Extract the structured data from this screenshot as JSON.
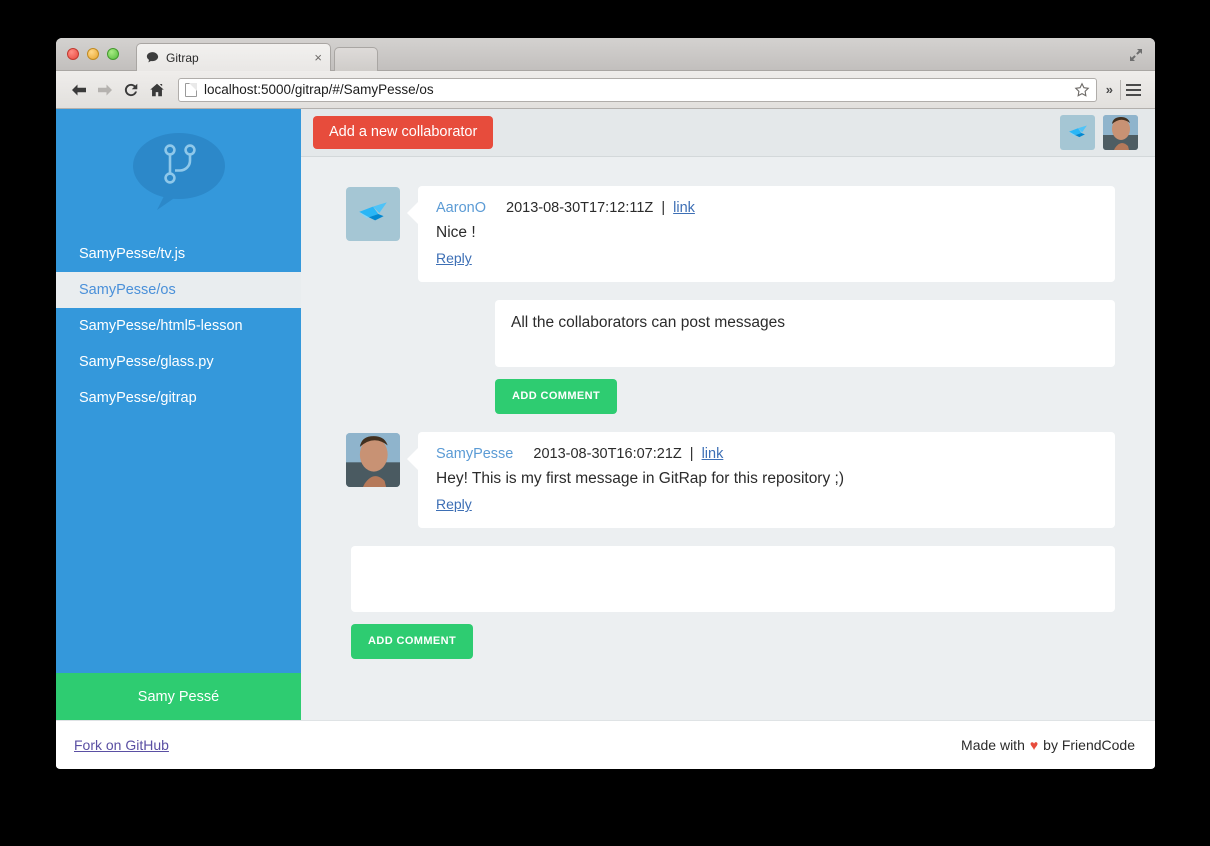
{
  "browser": {
    "tab_title": "Gitrap",
    "tab_close_label": "×",
    "url": "localhost:5000/gitrap/#/SamyPesse/os",
    "chevrons_label": "»",
    "nav": {
      "back": "back-arrow",
      "forward": "forward-arrow",
      "reload": "reload-arrow",
      "home": "home-icon",
      "bookmark": "star-icon",
      "menu": "hamburger-icon"
    }
  },
  "sidebar": {
    "logo_alt": "gitrap-speech-bubble-logo",
    "repos": [
      {
        "label": "SamyPesse/tv.js",
        "active": false
      },
      {
        "label": "SamyPesse/os",
        "active": true
      },
      {
        "label": "SamyPesse/html5-lesson",
        "active": false
      },
      {
        "label": "SamyPesse/glass.py",
        "active": false
      },
      {
        "label": "SamyPesse/gitrap",
        "active": false
      }
    ],
    "user_name": "Samy Pessé"
  },
  "header": {
    "add_collaborator_label": "Add a new collaborator",
    "avatars": [
      {
        "name": "crane-avatar",
        "type": "crane"
      },
      {
        "name": "samy-avatar",
        "type": "photo"
      }
    ]
  },
  "comments": [
    {
      "avatar": "crane",
      "author": "AaronO",
      "date": "2013-08-30T17:12:11Z",
      "separator": "|",
      "link_label": "link",
      "text": "Nice !",
      "reply_label": "Reply",
      "reply_composer": {
        "value": "All the collaborators can post messages",
        "placeholder": "",
        "button_label": "ADD COMMENT"
      }
    },
    {
      "avatar": "photo",
      "author": "SamyPesse",
      "date": "2013-08-30T16:07:21Z",
      "separator": "|",
      "link_label": "link",
      "text": "Hey! This is my first message in GitRap for this repository ;)",
      "reply_label": "Reply",
      "reply_composer": null
    }
  ],
  "root_composer": {
    "value": "",
    "placeholder": "",
    "button_label": "ADD COMMENT"
  },
  "footer": {
    "fork_label": "Fork on GitHub",
    "credit_prefix": "Made with",
    "heart": "♥",
    "credit_suffix": "by FriendCode"
  },
  "colors": {
    "sidebar_blue": "#3498db",
    "accent_green": "#2ecc71",
    "accent_red": "#e74c3c",
    "content_bg": "#eceff1",
    "link_blue": "#3d6fb5"
  }
}
